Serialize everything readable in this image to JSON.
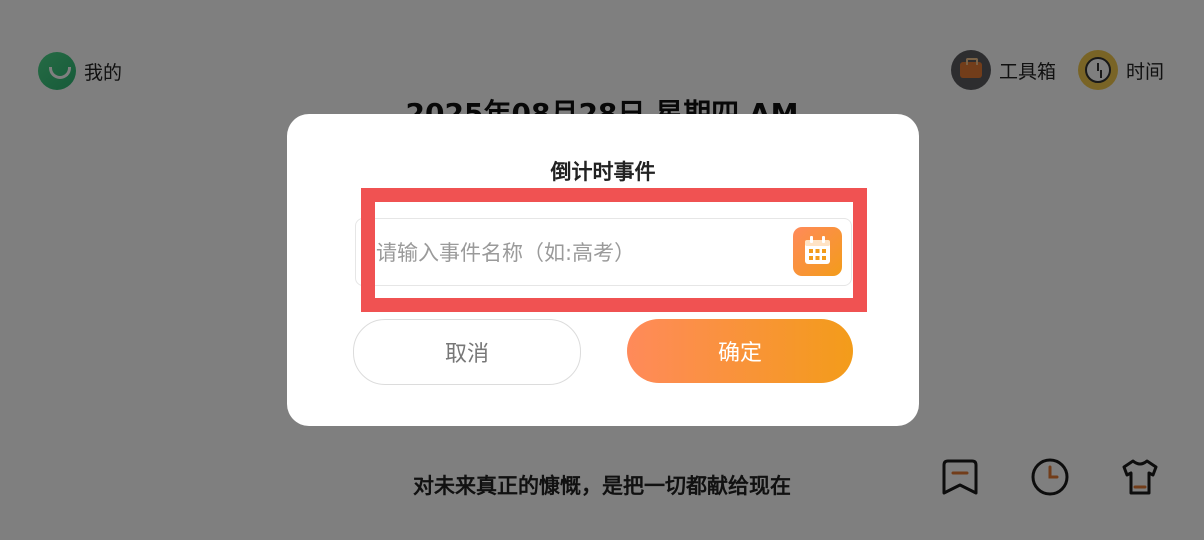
{
  "header": {
    "profile_label": "我的",
    "toolbox_label": "工具箱",
    "time_label": "时间"
  },
  "date_line": "2025年08月28日 星期四 AM",
  "quote": "对未来真正的慷慨，是把一切都献给现在",
  "dialog": {
    "title": "倒计时事件",
    "input_placeholder": "请输入事件名称（如:高考）",
    "input_value": "",
    "cancel_label": "取消",
    "confirm_label": "确定"
  },
  "icons": {
    "profile": "avatar-smile-icon",
    "toolbox": "toolbox-icon",
    "time": "clock-icon",
    "calendar": "calendar-icon",
    "bottom": [
      "bookmark-icon",
      "clock-icon",
      "tshirt-icon"
    ]
  },
  "colors": {
    "accent_start": "#ff8a5a",
    "accent_end": "#f39c1a",
    "highlight": "#f05252",
    "overlay": "rgba(0,0,0,0.5)"
  }
}
